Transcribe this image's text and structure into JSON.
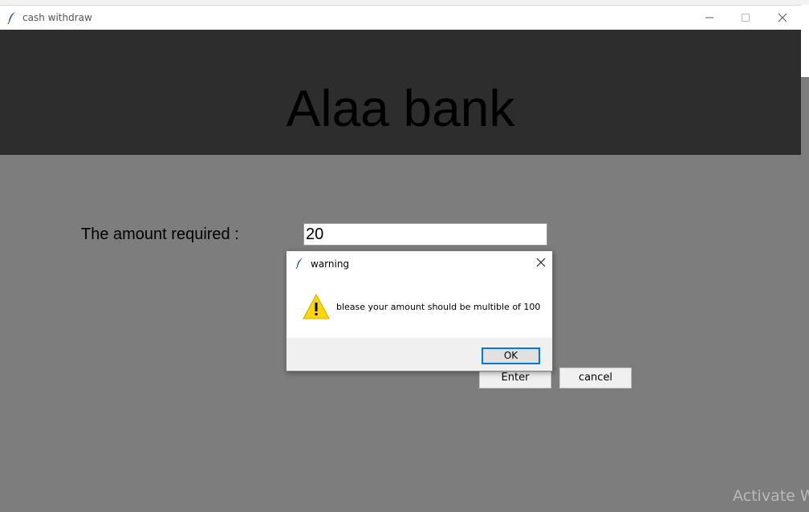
{
  "window": {
    "title": "cash withdraw",
    "icon": "feather-icon"
  },
  "banner": {
    "bank_name": "Alaa bank"
  },
  "form": {
    "amount_label": "The amount required :",
    "amount_value": "20",
    "enter_label": "Enter",
    "cancel_label": "cancel"
  },
  "dialog": {
    "title": "warning",
    "message": "blease your amount should be multible of 100",
    "ok_label": "OK",
    "icon": "warning-icon"
  },
  "watermark": {
    "text": "Activate W"
  },
  "colors": {
    "banner": "#2d2d2d",
    "body": "#7d7d7d",
    "focus": "#0078d7",
    "warning": "#ffd700"
  }
}
